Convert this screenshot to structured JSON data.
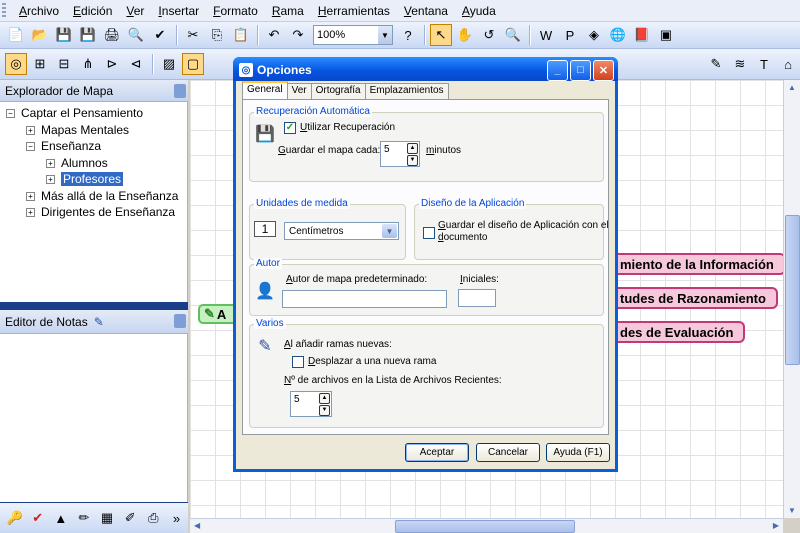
{
  "menu": [
    "Archivo",
    "Edición",
    "Ver",
    "Insertar",
    "Formato",
    "Rama",
    "Herramientas",
    "Ventana",
    "Ayuda"
  ],
  "toolbar": {
    "zoom": "100%"
  },
  "map_explorer": {
    "title": "Explorador de Mapa",
    "tree": [
      {
        "label": "Captar el Pensamiento",
        "expander": "−"
      },
      {
        "label": "Mapas Mentales",
        "expander": "+"
      },
      {
        "label": "Enseñanza",
        "expander": "−"
      },
      {
        "label": "Alumnos",
        "expander": "+"
      },
      {
        "label": "Profesores",
        "expander": "+"
      },
      {
        "label": "Más allá de la Enseñanza",
        "expander": "+"
      },
      {
        "label": "Dirigentes de Enseñanza",
        "expander": "+"
      }
    ]
  },
  "notes_editor": {
    "title": "Editor de Notas"
  },
  "canvas": {
    "central_topic": "A",
    "topics": [
      "miento de la Información",
      "tudes de Razonamiento",
      "des de Evaluación"
    ],
    "colors": {
      "topic_fill": "#f6c8da",
      "topic_border": "#c03a78",
      "central_fill": "#c8f0c0"
    }
  },
  "dialog": {
    "title": "Opciones",
    "tabs": [
      "General",
      "Ver",
      "Ortografía",
      "Emplazamientos"
    ],
    "active_tab": "General",
    "autosave": {
      "group_title": "Recuperación Automática",
      "checkbox_label": "Utilizar Recuperación",
      "checked": true,
      "save_every_label": "Guardar el mapa cada:",
      "save_every_value": "5",
      "unit": "minutos"
    },
    "units": {
      "group_title": "Unidades de medida",
      "selected": "Centímetros"
    },
    "app_design": {
      "group_title": "Diseño de la Aplicación",
      "checkbox_label_line1": "Guardar el diseño de Aplicación con el",
      "checkbox_label_line2": "documento",
      "checked": false
    },
    "author": {
      "group_title": "Autor",
      "default_author_label": "Autor de mapa predeterminado:",
      "default_author_value": "",
      "initials_label": "Iniciales:",
      "initials_value": ""
    },
    "misc": {
      "group_title": "Varios",
      "new_branches_label": "Al añadir ramas nuevas:",
      "move_to_new_branch_label": "Desplazar a una nueva rama",
      "move_checked": false,
      "recent_files_label": "Nº de archivos en la Lista de Archivos Recientes:",
      "recent_files_value": "5"
    },
    "buttons": {
      "accept": "Aceptar",
      "cancel": "Cancelar",
      "help": "Ayuda (F1)"
    }
  }
}
